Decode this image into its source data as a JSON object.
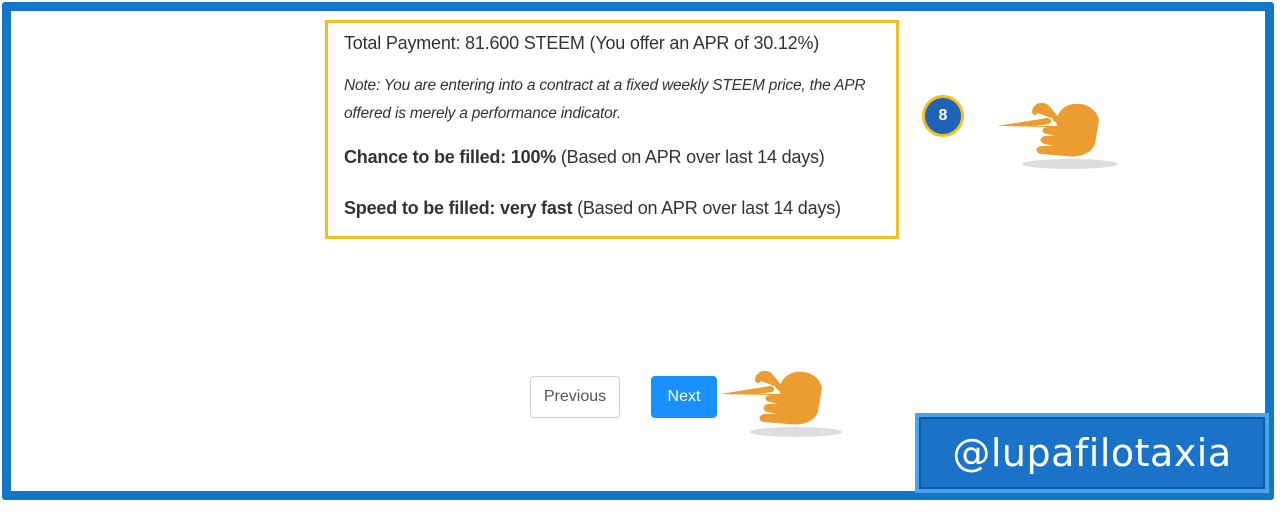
{
  "summary": {
    "total_payment": "Total Payment: 81.600 STEEM (You offer an APR of 30.12%)",
    "note": "Note: You are entering into a contract at a fixed weekly STEEM price, the APR offered is merely a performance indicator.",
    "chance_label": "Chance to be filled: 100%",
    "chance_basis": " (Based on APR over last 14 days)",
    "speed_label": "Speed to be filled: very fast",
    "speed_basis": " (Based on APR over last 14 days)"
  },
  "annotations": {
    "step_number": "8",
    "pointer_icon": "pointing-hand-icon",
    "accent_color": "#f5bd1f",
    "frame_color": "#1277c6"
  },
  "navigation": {
    "previous_label": "Previous",
    "next_label": "Next",
    "next_color": "#1890ff"
  },
  "watermark": {
    "text": "@lupafilotaxia"
  }
}
